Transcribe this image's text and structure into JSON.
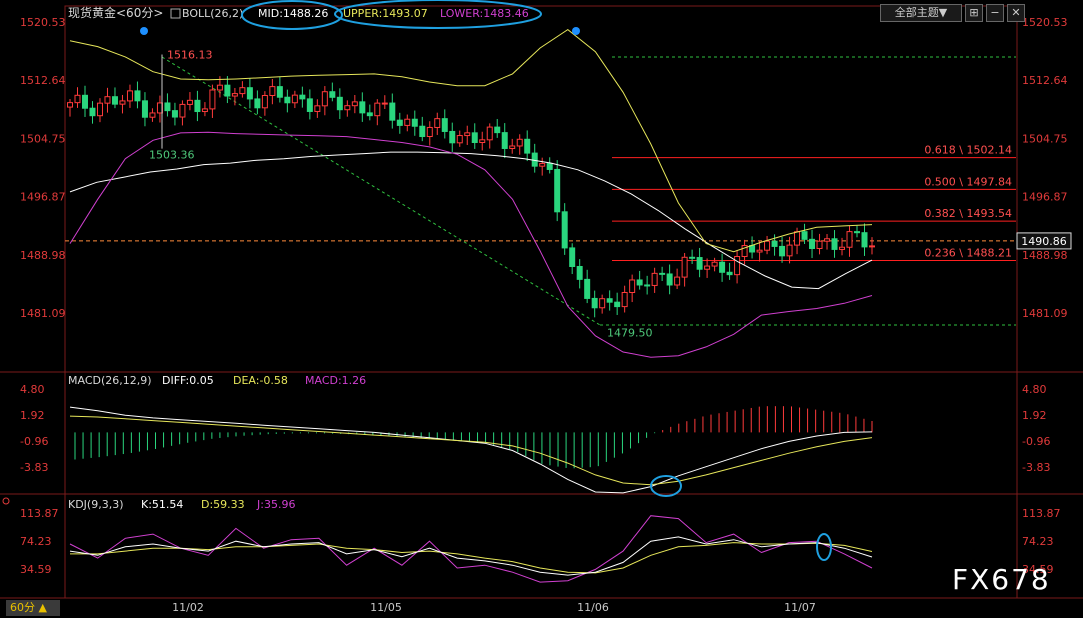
{
  "header": {
    "instrument": "现货黄金",
    "period": "<60分>",
    "boll_label": "BOLL(26,2)",
    "mid_label": "MID:1488.26",
    "upper_label": "UPPER:1493.07",
    "lower_label": "LOWER:1483.46"
  },
  "toolbar": {
    "theme_label": "全部主题▼",
    "buttons": [
      "⊞",
      "−",
      "✕"
    ]
  },
  "price_axis": {
    "ticks": [
      "1520.53",
      "1512.64",
      "1504.75",
      "1496.87",
      "1488.98",
      "1481.09"
    ],
    "current": "1490.86"
  },
  "annotations": {
    "high_1": "1516.13",
    "low_1": "1503.36",
    "low_2": "1479.50"
  },
  "fib_levels": [
    {
      "label": "0.618 \\ 1502.14",
      "value": 1502.14
    },
    {
      "label": "0.500 \\ 1497.84",
      "value": 1497.84
    },
    {
      "label": "0.382 \\ 1493.54",
      "value": 1493.54
    },
    {
      "label": "0.236 \\ 1488.21",
      "value": 1488.21
    }
  ],
  "macd": {
    "label": "MACD(26,12,9)",
    "diff_label": "DIFF:0.05",
    "dea_label": "DEA:-0.58",
    "macd_label": "MACD:1.26",
    "ticks": [
      "4.80",
      "1.92",
      "-0.96",
      "-3.83"
    ]
  },
  "kdj": {
    "label": "KDJ(9,3,3)",
    "k_label": "K:51.54",
    "d_label": "D:59.33",
    "j_label": "J:35.96",
    "ticks": [
      "113.87",
      "74.23",
      "34.59"
    ]
  },
  "x_axis": {
    "dates": [
      "11/02",
      "11/05",
      "11/06",
      "11/07"
    ]
  },
  "timeframe_button": "60分 ▲",
  "watermark": "FX678",
  "colors": {
    "up": "#ff3b3b",
    "down": "#2ad67e",
    "mid": "#ffffff",
    "upper": "#e6e65a",
    "lower": "#d040d0",
    "fib": "#ff2020",
    "current": "#ff8c3c"
  },
  "chart_data": [
    {
      "type": "candlestick",
      "title": "现货黄金 60分",
      "ylim": [
        1476,
        1522
      ],
      "y_ticks": [
        1520.53,
        1512.64,
        1504.75,
        1496.87,
        1488.98,
        1481.09
      ],
      "x_labels": [
        "11/02",
        "11/05",
        "11/06",
        "11/07"
      ],
      "series": [
        {
          "name": "MID",
          "values": [
            1497.5,
            1498.8,
            1499.5,
            1500.2,
            1500.6,
            1501.2,
            1501.4,
            1501.8,
            1502.0,
            1502.3,
            1502.5,
            1502.7,
            1502.9,
            1502.9,
            1502.8,
            1502.7,
            1502.4,
            1502.0,
            1501.4,
            1500.5,
            1499.0,
            1497.2,
            1495.0,
            1492.5,
            1490.2,
            1488.0,
            1486.1,
            1484.6,
            1484.4,
            1486.4,
            1488.26
          ]
        },
        {
          "name": "UPPER",
          "values": [
            1518.0,
            1517.2,
            1515.8,
            1513.8,
            1512.8,
            1512.7,
            1512.8,
            1513.0,
            1513.2,
            1513.3,
            1513.4,
            1513.5,
            1513.1,
            1512.4,
            1511.9,
            1511.9,
            1513.5,
            1517.0,
            1519.5,
            1516.5,
            1511.0,
            1504.0,
            1496.0,
            1490.5,
            1489.4,
            1490.7,
            1491.8,
            1492.7,
            1492.9,
            1493.07
          ]
        },
        {
          "name": "LOWER",
          "values": [
            1490.5,
            1496.5,
            1502.0,
            1504.5,
            1505.5,
            1505.6,
            1505.4,
            1505.3,
            1505.2,
            1505.1,
            1505.0,
            1504.6,
            1504.2,
            1503.6,
            1502.6,
            1500.5,
            1496.5,
            1489.5,
            1482.0,
            1478.0,
            1475.8,
            1475.1,
            1475.3,
            1476.5,
            1478.2,
            1480.8,
            1481.3,
            1481.7,
            1482.4,
            1483.46
          ]
        }
      ],
      "fib_levels": [
        1502.14,
        1497.84,
        1493.54,
        1488.21
      ],
      "annotations": {
        "1516.13": 1516.13,
        "1503.36": 1503.36,
        "1479.50": 1479.5
      }
    },
    {
      "type": "bar",
      "title": "MACD(26,12,9)",
      "ylim": [
        -7.5,
        6.5
      ],
      "series": [
        {
          "name": "DIFF",
          "values": [
            2.8,
            2.4,
            1.9,
            1.6,
            1.4,
            1.2,
            1.0,
            0.8,
            0.6,
            0.4,
            0.2,
            0.0,
            -0.3,
            -0.6,
            -0.9,
            -1.2,
            -2.0,
            -3.5,
            -5.2,
            -6.6,
            -6.7,
            -6.0,
            -4.8,
            -3.8,
            -2.8,
            -1.8,
            -1.0,
            -0.4,
            0.0,
            0.05
          ]
        },
        {
          "name": "DEA",
          "values": [
            1.8,
            1.7,
            1.5,
            1.3,
            1.1,
            0.9,
            0.7,
            0.5,
            0.3,
            0.1,
            -0.1,
            -0.3,
            -0.5,
            -0.7,
            -0.9,
            -1.1,
            -1.5,
            -2.3,
            -3.4,
            -4.7,
            -5.6,
            -5.8,
            -5.4,
            -4.7,
            -3.9,
            -3.1,
            -2.3,
            -1.6,
            -1.0,
            -0.58
          ]
        },
        {
          "name": "MACD",
          "values": [
            -3.0,
            -2.7,
            -2.3,
            -1.8,
            -1.2,
            -0.7,
            -0.4,
            -0.2,
            -0.1,
            -0.1,
            -0.2,
            -0.3,
            -0.5,
            -0.7,
            -0.9,
            -1.2,
            -2.0,
            -3.5,
            -4.0,
            -3.8,
            -2.2,
            -0.2,
            1.0,
            1.9,
            2.4,
            2.9,
            2.9,
            2.5,
            2.1,
            1.26
          ]
        }
      ]
    },
    {
      "type": "line",
      "title": "KDJ(9,3,3)",
      "ylim": [
        0,
        130
      ],
      "series": [
        {
          "name": "K",
          "values": [
            60,
            54,
            66,
            70,
            64,
            60,
            74,
            66,
            70,
            72,
            56,
            62,
            52,
            64,
            50,
            46,
            40,
            30,
            26,
            30,
            44,
            74,
            80,
            70,
            76,
            66,
            70,
            72,
            64,
            51.54
          ]
        },
        {
          "name": "D",
          "values": [
            56,
            56,
            60,
            64,
            64,
            62,
            66,
            66,
            68,
            70,
            64,
            62,
            58,
            60,
            56,
            50,
            45,
            36,
            30,
            29,
            36,
            54,
            66,
            68,
            72,
            70,
            70,
            71,
            68,
            59.33
          ]
        },
        {
          "name": "J",
          "values": [
            70,
            50,
            78,
            84,
            64,
            54,
            92,
            64,
            76,
            78,
            40,
            64,
            40,
            74,
            36,
            40,
            30,
            16,
            18,
            34,
            60,
            110,
            106,
            72,
            84,
            58,
            72,
            74,
            56,
            35.96
          ]
        }
      ]
    }
  ]
}
